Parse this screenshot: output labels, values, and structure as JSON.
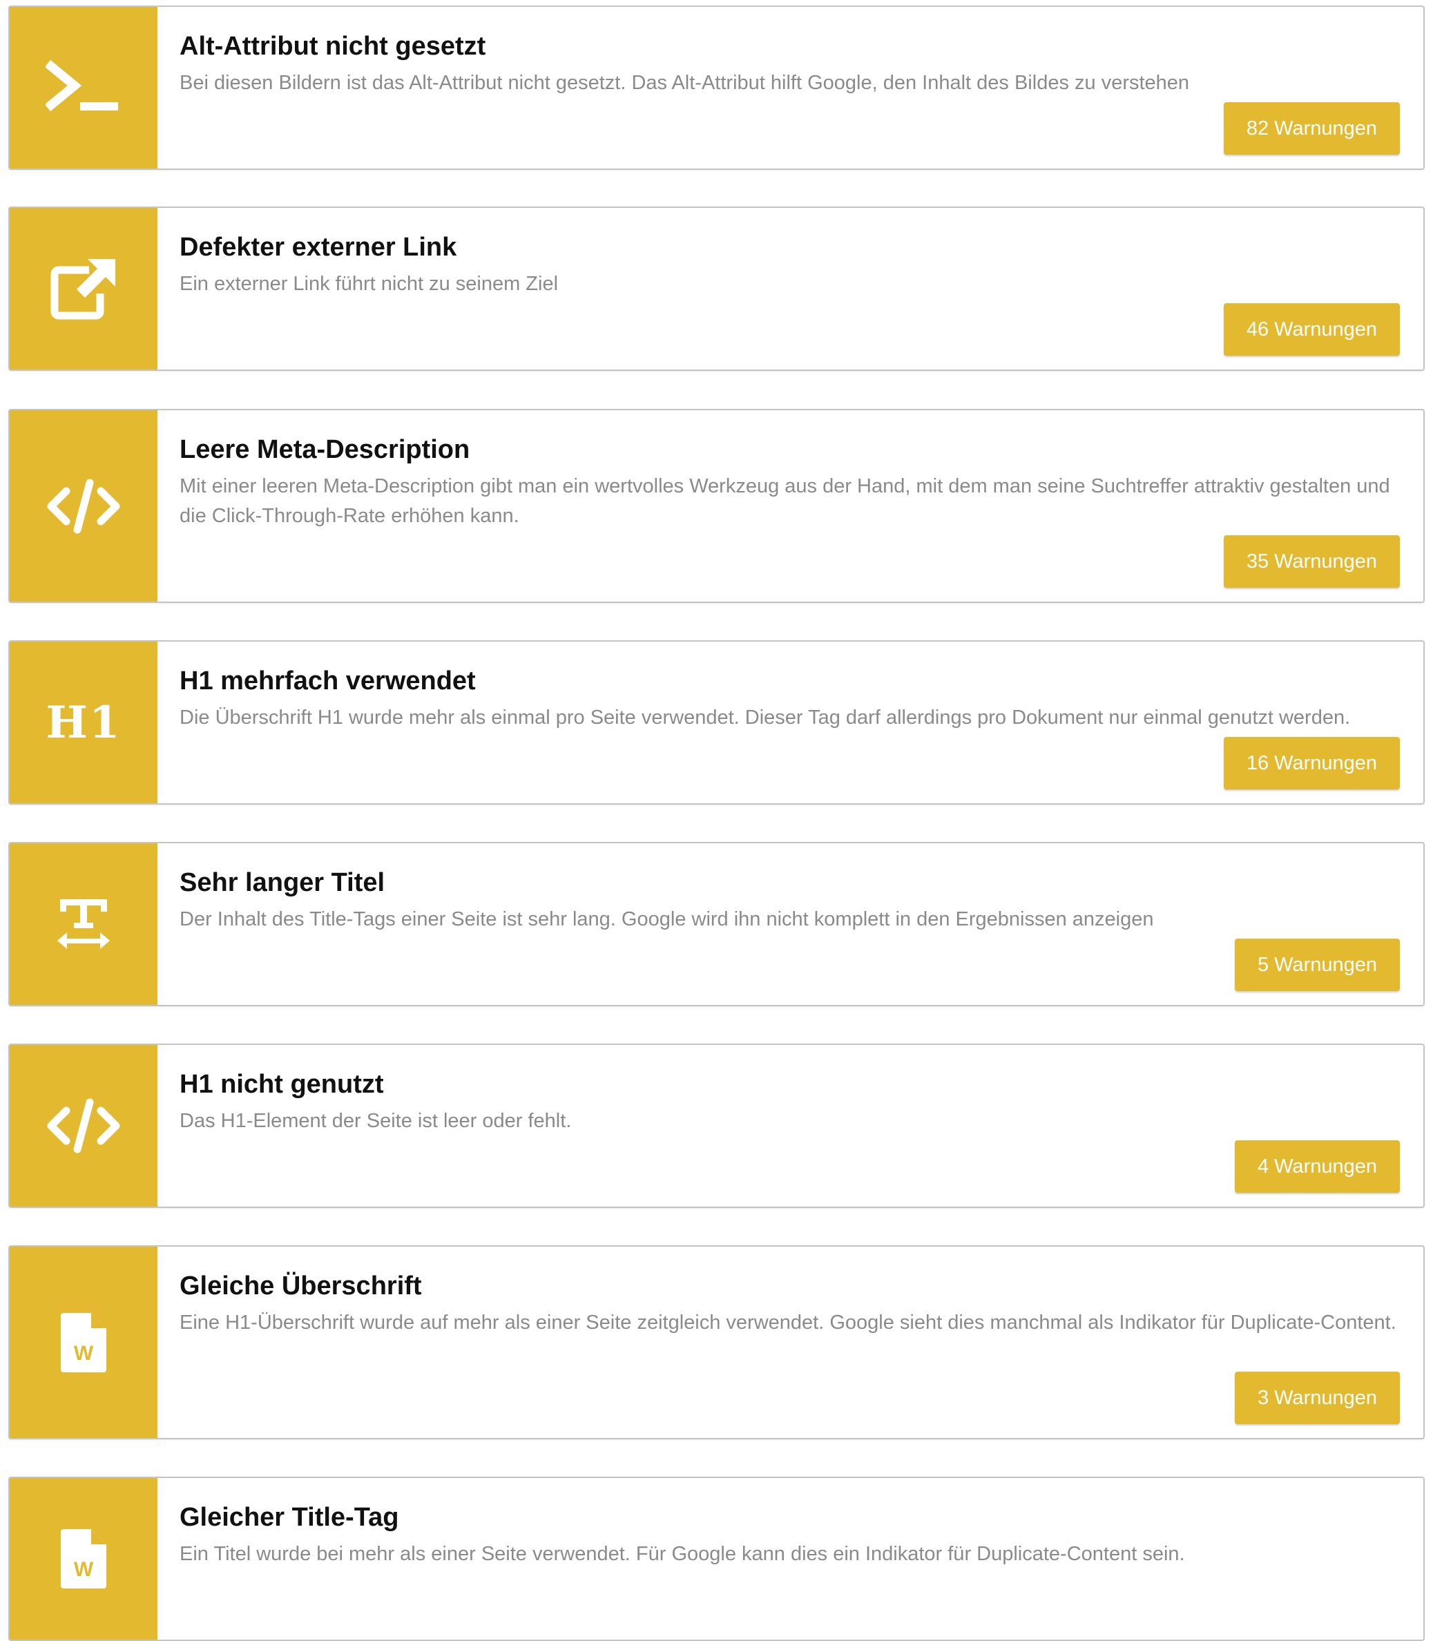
{
  "accent_color": "#E3B930",
  "items": [
    {
      "icon": "terminal-icon",
      "title": "Alt-Attribut nicht gesetzt",
      "description": "Bei diesen Bildern ist das Alt-Attribut nicht gesetzt. Das Alt-Attribut hilft Google, den Inhalt des Bildes zu verstehen",
      "button": "82 Warnungen"
    },
    {
      "icon": "external-link-icon",
      "title": "Defekter externer Link",
      "description": "Ein externer Link führt nicht zu seinem Ziel",
      "button": "46 Warnungen"
    },
    {
      "icon": "code-icon",
      "title": "Leere Meta-Description",
      "description": "Mit einer leeren Meta-Description gibt man ein wertvolles Werkzeug aus der Hand, mit dem man seine Suchtreffer attraktiv gestalten und die Click-Through-Rate erhöhen kann.",
      "button": "35 Warnungen"
    },
    {
      "icon": "h1-icon",
      "icon_text": "H1",
      "title": "H1 mehrfach verwendet",
      "description": "Die Überschrift H1 wurde mehr als einmal pro Seite verwendet. Dieser Tag darf allerdings pro Dokument nur einmal genutzt werden.",
      "button": "16 Warnungen"
    },
    {
      "icon": "text-width-icon",
      "title": "Sehr langer Titel",
      "description": "Der Inhalt des Title-Tags einer Seite ist sehr lang. Google wird ihn nicht komplett in den Ergebnissen anzeigen",
      "button": "5 Warnungen"
    },
    {
      "icon": "code-icon",
      "title": "H1 nicht genutzt",
      "description": "Das H1-Element der Seite ist leer oder fehlt.",
      "button": "4 Warnungen"
    },
    {
      "icon": "word-file-icon",
      "icon_text": "W",
      "title": "Gleiche Überschrift",
      "description": "Eine H1-Überschrift wurde auf mehr als einer Seite zeitgleich verwendet. Google sieht dies manchmal als Indikator für Duplicate-Content.",
      "button": "3 Warnungen"
    },
    {
      "icon": "word-file-icon",
      "icon_text": "W",
      "title": "Gleicher Title-Tag",
      "description": "Ein Titel wurde bei mehr als einer Seite verwendet. Für Google kann dies ein Indikator für Duplicate-Content sein.",
      "button": ""
    }
  ]
}
